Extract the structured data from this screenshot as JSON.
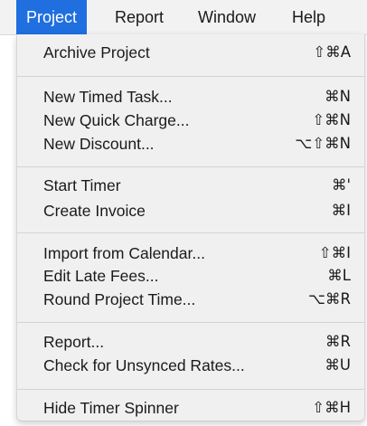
{
  "menubar": {
    "project": "Project",
    "report": "Report",
    "window": "Window",
    "help": "Help"
  },
  "colors": {
    "accent": "#1f6fe0",
    "menu_bg": "#f0f0f0"
  },
  "menu": {
    "items": [
      {
        "label": "Archive Project",
        "shortcut": "⇧⌘A"
      },
      {
        "label": "New Timed Task...",
        "shortcut": "⌘N"
      },
      {
        "label": "New Quick Charge...",
        "shortcut": "⇧⌘N"
      },
      {
        "label": "New Discount...",
        "shortcut": "⌥⇧⌘N"
      },
      {
        "label": "Start Timer",
        "shortcut": "⌘'"
      },
      {
        "label": "Create Invoice",
        "shortcut": "⌘I"
      },
      {
        "label": "Import from Calendar...",
        "shortcut": "⇧⌘I"
      },
      {
        "label": "Edit Late Fees...",
        "shortcut": "⌘L"
      },
      {
        "label": "Round Project Time...",
        "shortcut": "⌥⌘R"
      },
      {
        "label": "Report...",
        "shortcut": "⌘R"
      },
      {
        "label": "Check for Unsynced Rates...",
        "shortcut": "⌘U"
      },
      {
        "label": "Hide Timer Spinner",
        "shortcut": "⇧⌘H"
      }
    ]
  }
}
